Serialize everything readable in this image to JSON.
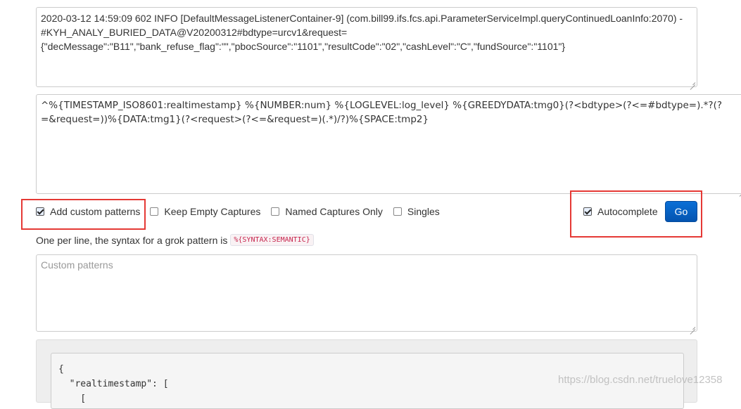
{
  "input_textarea": {
    "lines": [
      "2020-03-12 14:59:09 602 INFO  [DefaultMessageListenerContainer-9] (com.bill99.ifs.fcs.api.ParameterServiceImpl.queryContinuedLoanInfo:2070) -",
      "#KYH_ANALY_BURIED_DATA@V20200312#bdtype=urcv1&request=",
      "{\"decMessage\":\"B11\",\"bank_refuse_flag\":\"\",\"pbocSource\":\"1101\",\"resultCode\":\"02\",\"cashLevel\":\"C\",\"fundSource\":\"1101\"}"
    ]
  },
  "pattern_textarea": {
    "lines": [
      "^%{TIMESTAMP_ISO8601:realtimestamp} %{NUMBER:num} %{LOGLEVEL:log_level} %{GREEDYDATA:tmg0}(?<bdtype>(?<=#bdtype=).*?(?",
      "=&request=))%{DATA:tmg1}(?<request>(?<=&request=)(.*)/?)%{SPACE:tmp2}"
    ]
  },
  "options": {
    "add_custom_patterns": {
      "label": "Add custom patterns",
      "checked": true
    },
    "keep_empty_captures": {
      "label": "Keep Empty Captures",
      "checked": false
    },
    "named_captures_only": {
      "label": "Named Captures Only",
      "checked": false
    },
    "singles": {
      "label": "Singles",
      "checked": false
    },
    "autocomplete": {
      "label": "Autocomplete",
      "checked": true
    }
  },
  "go_button": {
    "label": "Go"
  },
  "hint": {
    "text": "One per line, the syntax for a grok pattern is",
    "syntax": "%{SYNTAX:SEMANTIC}"
  },
  "custom_patterns": {
    "placeholder": "Custom patterns",
    "value": ""
  },
  "result": {
    "lines": [
      "{",
      "  \"realtimestamp\": [",
      "    ["
    ]
  },
  "watermark": "https://blog.csdn.net/truelove12358",
  "colors": {
    "highlight_border": "#e53935",
    "go_button": "#0a6fd6"
  }
}
